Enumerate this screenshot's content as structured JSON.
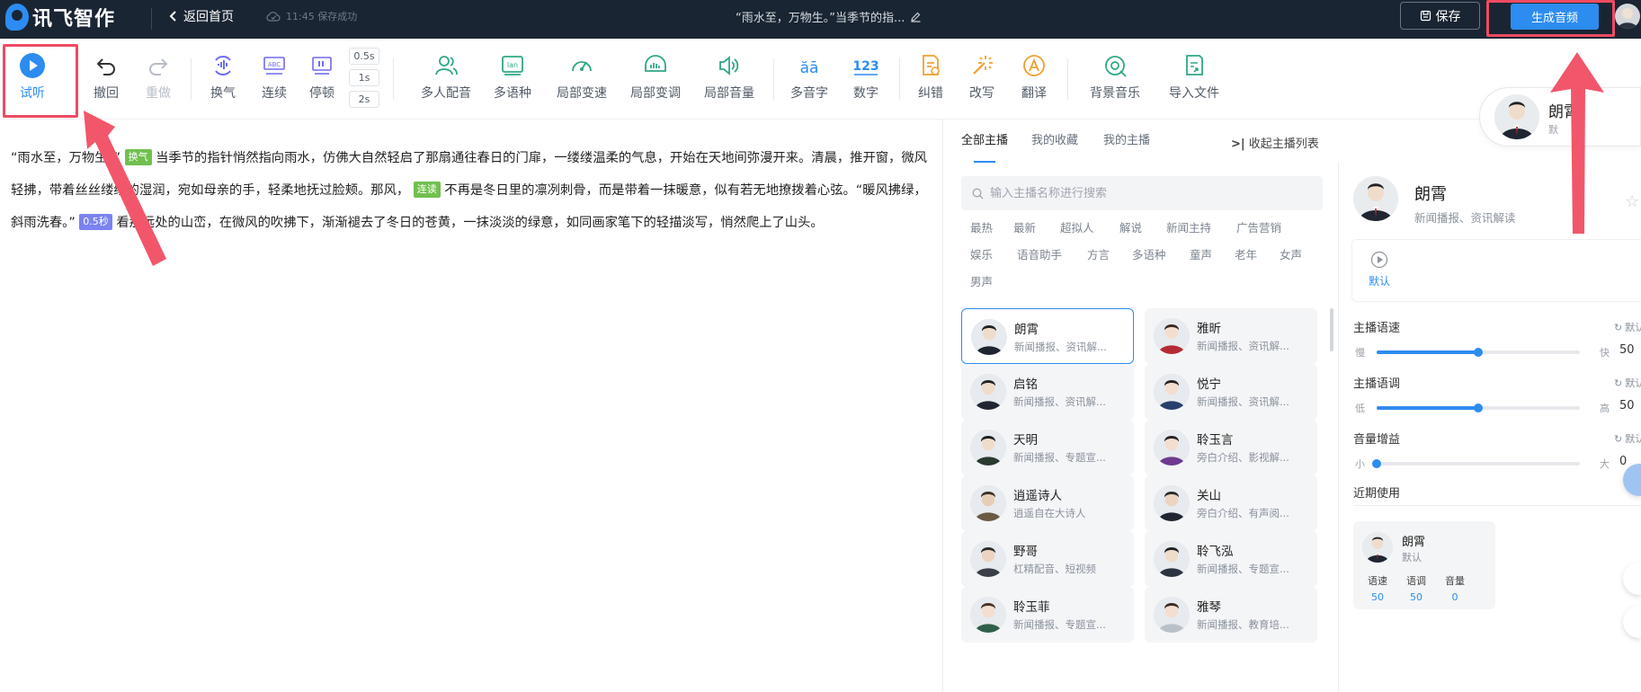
{
  "app": {
    "title": "讯飞智作"
  },
  "header": {
    "back_label": "返回首页",
    "save_status": "11:45 保存成功",
    "doc_title": "“雨水至，万物生。”当季节的指...",
    "save_label": "保存",
    "generate_label": "生成音频"
  },
  "toolbar": {
    "preview": "试听",
    "undo": "撤回",
    "redo": "重做",
    "breath": "换气",
    "liaison": "连续",
    "pause": "停顿",
    "pause_options": [
      "0.5s",
      "1s",
      "2s"
    ],
    "multi_voice": "多人配音",
    "multi_lang": "多语种",
    "local_speed": "局部变速",
    "local_pitch": "局部变调",
    "local_volume": "局部音量",
    "polyphone": "多音字",
    "number": "数字",
    "correct": "纠错",
    "rewrite": "改写",
    "translate": "翻译",
    "bgm": "背景音乐",
    "import": "导入文件"
  },
  "narrator_card": {
    "name": "朗霄",
    "sub": "默"
  },
  "editor": {
    "p1": "“雨水至，万物生。”",
    "tag_breath": "换气",
    "p2": "当季节的指针悄然指向雨水，仿佛大自然轻启了那扇通往春日的门扉，一缕缕温柔的气息，开始在天地间弥漫开来。清晨，推开窗，微风轻拂，带着丝丝缕缕的湿润，宛如母亲的手，轻柔地抚过脸颊。那风，",
    "tag_liaison": "连读",
    "p3": "不再是冬日里的凛冽刺骨，而是带着一抹暖意，似有若无地撩拨着心弦。“暖风拂绿，斜雨洗春。”",
    "tag_pause": "0.5秒",
    "p4": "看那远处的山峦，在微风的吹拂下，渐渐褪去了冬日的苍黄，一抹淡淡的绿意，如同画家笔下的轻描淡写，悄然爬上了山头。"
  },
  "anchor_panel": {
    "tabs": [
      "全部主播",
      "我的收藏",
      "我的主播"
    ],
    "collapse_label": "收起主播列表",
    "search_placeholder": "输入主播名称进行搜索",
    "categories": [
      "最热",
      "最新",
      "超拟人",
      "解说",
      "新闻主持",
      "广告营销",
      "娱乐",
      "语音助手",
      "方言",
      "多语种",
      "童声",
      "老年",
      "女声",
      "男声"
    ],
    "anchors": [
      {
        "name": "朗霄",
        "desc": "新闻播报、资讯解..."
      },
      {
        "name": "雅昕",
        "desc": "新闻播报、资讯解..."
      },
      {
        "name": "启铭",
        "desc": "新闻播报、资讯解..."
      },
      {
        "name": "悦宁",
        "desc": "新闻播报、资讯解..."
      },
      {
        "name": "天明",
        "desc": "新闻播报、专题宣..."
      },
      {
        "name": "聆玉言",
        "desc": "旁白介绍、影视解..."
      },
      {
        "name": "逍遥诗人",
        "desc": "逍遥自在大诗人"
      },
      {
        "name": "关山",
        "desc": "旁白介绍、有声阅..."
      },
      {
        "name": "野哥",
        "desc": "杠精配音、短视频"
      },
      {
        "name": "聆飞泓",
        "desc": "新闻播报、专题宣..."
      },
      {
        "name": "聆玉菲",
        "desc": "新闻播报、专题宣..."
      },
      {
        "name": "雅琴",
        "desc": "新闻播报、教育培..."
      }
    ]
  },
  "detail": {
    "name": "朗霄",
    "desc": "新闻播报、资讯解读",
    "style": "默认",
    "speed": {
      "label": "主播语速",
      "reset": "默认",
      "min": "慢",
      "max": "快",
      "value": "50",
      "fraction": 0.5
    },
    "pitch": {
      "label": "主播语调",
      "reset": "默认",
      "min": "低",
      "max": "高",
      "value": "50",
      "fraction": 0.5
    },
    "volume": {
      "label": "音量增益",
      "reset": "默认",
      "min": "小",
      "max": "大",
      "value": "0",
      "fraction": 0.0
    },
    "recent_label": "近期使用",
    "recent": {
      "name": "朗霄",
      "style": "默认",
      "speed_label": "语速",
      "speed": "50",
      "pitch_label": "语调",
      "pitch": "50",
      "volume_label": "音量",
      "volume": "0"
    }
  },
  "colors": {
    "accent": "#2d8cf0",
    "header_bg": "#1a2533",
    "highlight": "#ee4b62",
    "tag_green": "#71c04f",
    "tag_purple": "#7b83f0",
    "orange_icons": "#f0a02e",
    "teal_icons": "#2fa786"
  }
}
